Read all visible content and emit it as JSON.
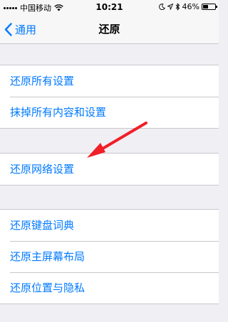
{
  "status_bar": {
    "carrier": "中国移动",
    "time": "10:21",
    "battery_percent": "46%",
    "battery_level": 0.46,
    "icons": [
      "signal-dots-icon",
      "wifi-icon",
      "moon-icon",
      "location-icon",
      "bluetooth-icon",
      "battery-icon"
    ]
  },
  "nav": {
    "back_label": "通用",
    "title": "还原"
  },
  "groups": [
    {
      "items": [
        "还原所有设置",
        "抹掉所有内容和设置"
      ]
    },
    {
      "items": [
        "还原网络设置"
      ]
    },
    {
      "items": [
        "还原键盘词典",
        "还原主屏幕布局",
        "还原位置与隐私"
      ]
    }
  ],
  "colors": {
    "accent": "#007aff",
    "annotation_arrow": "#f01f28",
    "background": "#efeff4"
  }
}
